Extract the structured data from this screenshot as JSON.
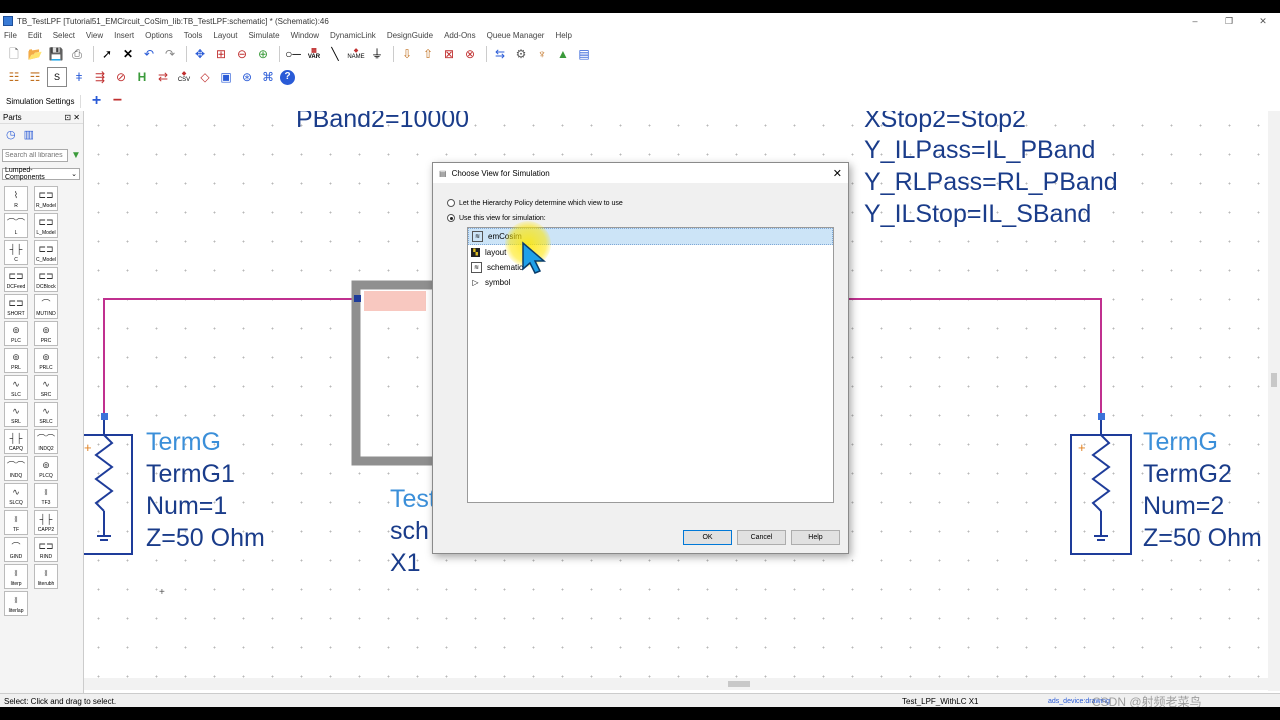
{
  "window": {
    "title": "TB_TestLPF [Tutorial51_EMCircuit_CoSim_lib:TB_TestLPF:schematic] * (Schematic):46",
    "controls": [
      "‒",
      "❐",
      "✕"
    ]
  },
  "menu": [
    "File",
    "Edit",
    "Select",
    "View",
    "Insert",
    "Options",
    "Tools",
    "Layout",
    "Simulate",
    "Window",
    "DynamicLink",
    "DesignGuide",
    "Add-Ons",
    "Queue Manager",
    "Help"
  ],
  "toolbar": {
    "var_label": "VAR",
    "name_label": "NAME",
    "csv_label": "CSV",
    "h_label": "H",
    "help_label": "?"
  },
  "simbar": {
    "settings_label": "Simulation Settings"
  },
  "parts": {
    "header": "Parts",
    "search_placeholder": "Search all libraries",
    "library": "Lumped-Components",
    "items": [
      "R",
      "R_Model",
      "L",
      "L_Model",
      "C",
      "C_Model",
      "DCFeed",
      "DCBlock",
      "SHORT",
      "MUTIND",
      "PLC",
      "PRC",
      "PRL",
      "PRLC",
      "SLC",
      "SRC",
      "SRL",
      "SRLC",
      "CAPQ",
      "INDQ2",
      "INDQ",
      "PLCQ",
      "SLCQ",
      "TF3",
      "TF",
      "CAPP2",
      "GIND",
      "RIND",
      "Iiterp",
      "Iiterubh",
      "Iiterlap"
    ]
  },
  "canvas": {
    "top_left_text": "PBand2=10000",
    "top_right_lines": [
      "XStop2=Stop2",
      "Y_ILPass=IL_PBand",
      "Y_RLPass=RL_PBand",
      "Y_ILStop=IL_SBand"
    ],
    "term1": [
      "TermG",
      "TermG1",
      "Num=1",
      "Z=50 Ohm"
    ],
    "term2": [
      "TermG",
      "TermG2",
      "Num=2",
      "Z=50 Ohm"
    ],
    "sub": [
      "Test",
      "sch",
      "X1"
    ],
    "colors": {
      "wire": "#c0308f",
      "component": "#1e3c9a",
      "label": "#3b8fd9"
    }
  },
  "dialog": {
    "title": "Choose View for Simulation",
    "option1": "Let the Hierarchy Policy determine which view to use",
    "option2": "Use this view for simulation:",
    "views": [
      {
        "name": "emCosim",
        "icon": "emcosim-icon"
      },
      {
        "name": "layout",
        "icon": "layout-icon"
      },
      {
        "name": "schematic",
        "icon": "schematic-icon"
      },
      {
        "name": "symbol",
        "icon": "symbol-icon"
      }
    ],
    "selected": "emCosim",
    "ok": "OK",
    "cancel": "Cancel",
    "help": "Help"
  },
  "status": {
    "left": "Select: Click and drag to select.",
    "middle": "Test_LPF_WithLC X1",
    "right": "ads_device:drawing",
    "watermark": "CSDN @射频老菜鸟"
  }
}
